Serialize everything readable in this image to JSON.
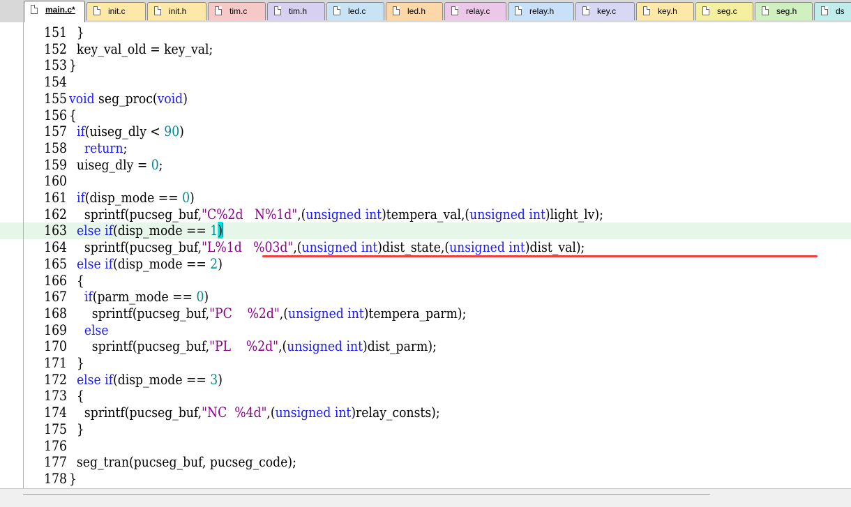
{
  "tabs": [
    {
      "label": "main.c*",
      "color": "#ffffff",
      "active": true
    },
    {
      "label": "init.c",
      "color": "#fde8a8"
    },
    {
      "label": "init.h",
      "color": "#fde8a8"
    },
    {
      "label": "tim.c",
      "color": "#f7c8c8"
    },
    {
      "label": "tim.h",
      "color": "#d8d0f0"
    },
    {
      "label": "led.c",
      "color": "#c8e4f4"
    },
    {
      "label": "led.h",
      "color": "#fcd8a8"
    },
    {
      "label": "relay.c",
      "color": "#ecc8e8"
    },
    {
      "label": "relay.h",
      "color": "#c8e0f8"
    },
    {
      "label": "key.c",
      "color": "#d8d8f4"
    },
    {
      "label": "key.h",
      "color": "#fde8a8"
    },
    {
      "label": "seg.c",
      "color": "#f4f0a0"
    },
    {
      "label": "seg.h",
      "color": "#d0f0c0"
    },
    {
      "label": "ds",
      "color": "#c0ecec"
    }
  ],
  "lines": [
    {
      "n": "151",
      "t": "  }"
    },
    {
      "n": "152",
      "t": "  key_val_old = key_val;"
    },
    {
      "n": "153",
      "t": "}"
    },
    {
      "n": "154",
      "t": ""
    },
    {
      "n": "155",
      "t": "void seg_proc(void)"
    },
    {
      "n": "156",
      "t": "{"
    },
    {
      "n": "157",
      "t": "  if(uiseg_dly < 90)"
    },
    {
      "n": "158",
      "t": "    return;"
    },
    {
      "n": "159",
      "t": "  uiseg_dly = 0;"
    },
    {
      "n": "160",
      "t": ""
    },
    {
      "n": "161",
      "t": "  if(disp_mode == 0)"
    },
    {
      "n": "162",
      "t": "    sprintf(pucseg_buf,\"C%2d   N%1d\",(unsigned int)tempera_val,(unsigned int)light_lv);"
    },
    {
      "n": "163",
      "t": "  else if(disp_mode == 1)"
    },
    {
      "n": "164",
      "t": "    sprintf(pucseg_buf,\"L%1d   %03d\",(unsigned int)dist_state,(unsigned int)dist_val);"
    },
    {
      "n": "165",
      "t": "  else if(disp_mode == 2)"
    },
    {
      "n": "166",
      "t": "  {"
    },
    {
      "n": "167",
      "t": "    if(parm_mode == 0)"
    },
    {
      "n": "168",
      "t": "      sprintf(pucseg_buf,\"PC    %2d\",(unsigned int)tempera_parm);"
    },
    {
      "n": "169",
      "t": "    else"
    },
    {
      "n": "170",
      "t": "      sprintf(pucseg_buf,\"PL    %2d\",(unsigned int)dist_parm);"
    },
    {
      "n": "171",
      "t": "  }"
    },
    {
      "n": "172",
      "t": "  else if(disp_mode == 3)"
    },
    {
      "n": "173",
      "t": "  {"
    },
    {
      "n": "174",
      "t": "    sprintf(pucseg_buf,\"NC  %4d\",(unsigned int)relay_consts);"
    },
    {
      "n": "175",
      "t": "  }"
    },
    {
      "n": "176",
      "t": ""
    },
    {
      "n": "177",
      "t": "  seg_tran(pucseg_buf, pucseg_code);"
    },
    {
      "n": "178",
      "t": "}"
    }
  ],
  "current_line": "163",
  "underlined_line": "164",
  "colors": {
    "keyword": "#1a1aff",
    "number": "#008b8b",
    "string": "#8b008b",
    "current_line_bg": "#e6f7ea",
    "brace_match": "#00e0e0",
    "underline": "#f04040"
  },
  "keywords": [
    "void",
    "if",
    "else",
    "return",
    "unsigned",
    "int"
  ]
}
